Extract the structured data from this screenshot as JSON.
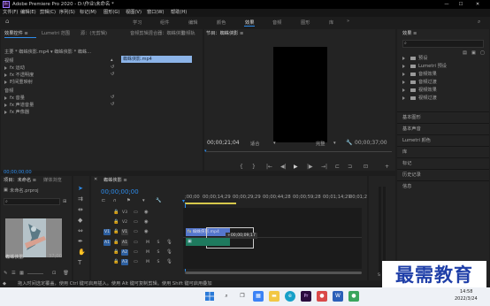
{
  "titlebar": {
    "title": "Adobe Premiere Pro 2020 - D:\\作业\\未命名 *",
    "app_icon": "Pr"
  },
  "menu": [
    "文件(F)",
    "编辑(E)",
    "剪辑(C)",
    "序列(S)",
    "标记(M)",
    "图形(G)",
    "视图(V)",
    "窗口(W)",
    "帮助(H)"
  ],
  "workspaces": [
    "学习",
    "组件",
    "编辑",
    "颜色",
    "效果",
    "音频",
    "图形",
    "库"
  ],
  "workspace_active": "效果",
  "effect_controls": {
    "tabs": [
      "效果控件 ≡",
      "Lumetri 范围",
      "源：(无剪辑)",
      "音频剪辑混合器：蜘蛛侠影",
      "音频轨"
    ],
    "clip_label": "主要 * 蜘蛛侠影.mp4 ▾ 蜘蛛侠影 * 蜘蛛...",
    "clip_bar": "蜘蛛侠影.mp4",
    "video_header": "视频",
    "video_items": [
      "fx 运动",
      "fx 不透明度",
      "时间重映射"
    ],
    "audio_header": "音频",
    "audio_items": [
      "fx 音量",
      "fx 声道音量",
      "fx 声像器"
    ],
    "timecode": "00;00;00;00"
  },
  "program_monitor": {
    "tab": "节目：蜘蛛侠影 ≡",
    "timecode_left": "00;00;21;04",
    "fit": "适合",
    "quality": "完整",
    "timecode_right": "00;00;37;00",
    "controls": [
      "{",
      "}",
      "|←",
      "◀|",
      "▶",
      "|▶",
      "→|",
      "⊏",
      "⊐",
      "⊡",
      "+"
    ]
  },
  "effects_panel": {
    "tab": "效果 ≡",
    "search_placeholder": "",
    "folders": [
      "预设",
      "Lumetri 预设",
      "音频效果",
      "音频过渡",
      "视频效果",
      "视频过渡"
    ],
    "sections": [
      "基本图形",
      "基本声音",
      "Lumetri 颜色",
      "库",
      "标记",
      "历史记录",
      "信息"
    ]
  },
  "project_panel": {
    "tab": "项目：未命名 ≡",
    "tab2": "媒体浏览",
    "file": "未命名.prproj",
    "item_name": "蜘蛛侠影",
    "item_duration": "37;00"
  },
  "timeline": {
    "tab": "蜘蛛侠影 ≡",
    "timecode": "00;00;00;00",
    "ruler": [
      ";00;00",
      "00;00;14;29",
      "00;00;29;29",
      "00;00;44;28",
      "00;00;59;28",
      "00;01;14;29",
      "00;01;2"
    ],
    "video_tracks": [
      "V3",
      "V2",
      "V1"
    ],
    "audio_tracks": [
      "A1",
      "A2",
      "A3"
    ],
    "clip_label": "蜘蛛侠影.mp4",
    "drag_tooltip": "+00;00;09;17",
    "track_buttons": [
      "M",
      "S"
    ]
  },
  "status_bar": "拖入时间选定覆盖，使用 Ctrl 键可启用插入。使用 Alt 键可复制剪辑。使用 Shift 键可启用叠加",
  "taskbar": {
    "time": "14:58",
    "date": "2022/3/24"
  },
  "watermark": "最需教育",
  "colors": {
    "accent": "#2d8ceb",
    "audio_clip": "#1e7a5e",
    "video_clip": "#5577cc",
    "selection": "#8cb4e8"
  }
}
